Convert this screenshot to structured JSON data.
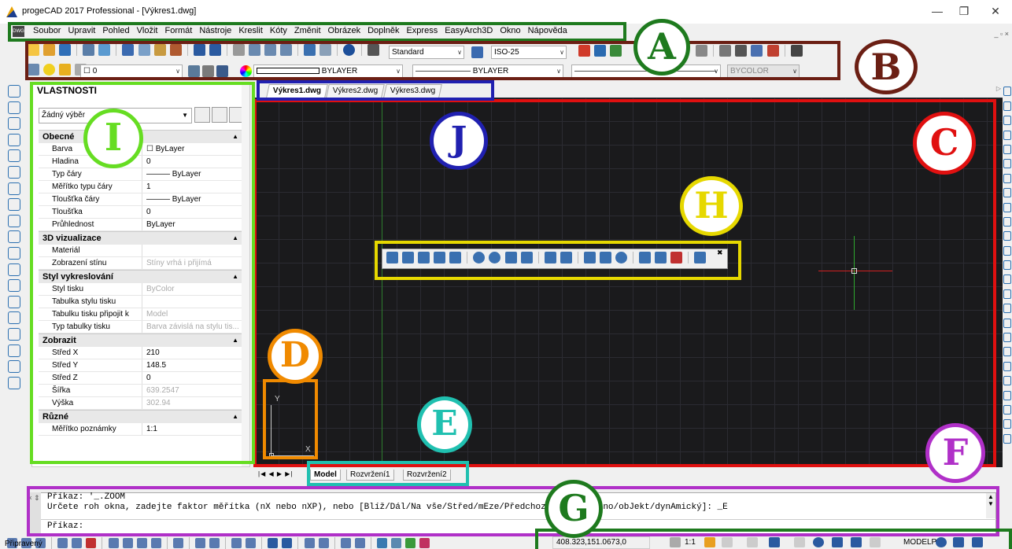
{
  "window": {
    "title": "progeCAD 2017 Professional - [Výkres1.dwg]",
    "controls": [
      "—",
      "❐",
      "✕"
    ]
  },
  "menubar": {
    "icon": "dwg-icon",
    "items": [
      "Soubor",
      "Upravit",
      "Pohled",
      "Vložit",
      "Formát",
      "Nástroje",
      "Kreslit",
      "Kóty",
      "Změnit",
      "Obrázek",
      "Doplněk",
      "Express",
      "EasyArch3D",
      "Okno",
      "Nápověda"
    ],
    "mdi_controls": "_ ▫ ×"
  },
  "toolbar": {
    "text_style": "Standard",
    "dim_style": "ISO-25",
    "layer": "0",
    "color": "BYLAYER",
    "linetype": "BYLAYER",
    "plotstyle": "BYCOLOR"
  },
  "properties": {
    "title": "VLASTNOSTI",
    "selection": "Žádný výběr",
    "categories": [
      {
        "name": "Obecné",
        "rows": [
          {
            "k": "Barva",
            "v": "☐ ByLayer"
          },
          {
            "k": "Hladina",
            "v": "0"
          },
          {
            "k": "Typ čáry",
            "v": "——— ByLayer"
          },
          {
            "k": "Měřítko typu čáry",
            "v": "1"
          },
          {
            "k": "Tloušťka čáry",
            "v": "——— ByLayer"
          },
          {
            "k": "Tloušťka",
            "v": "0"
          },
          {
            "k": "Průhlednost",
            "v": "ByLayer"
          }
        ]
      },
      {
        "name": "3D vizualizace",
        "rows": [
          {
            "k": "Materiál",
            "v": ""
          },
          {
            "k": "Zobrazení stínu",
            "v": "Stíny vrhá i přijímá",
            "dim": true
          }
        ]
      },
      {
        "name": "Styl vykreslování",
        "rows": [
          {
            "k": "Styl tisku",
            "v": "ByColor",
            "dim": true
          },
          {
            "k": "Tabulka stylu tisku",
            "v": ""
          },
          {
            "k": "Tabulku tisku připojit k",
            "v": "Model",
            "dim": true
          },
          {
            "k": "Typ tabulky tisku",
            "v": "Barva závislá na stylu tis...",
            "dim": true
          }
        ]
      },
      {
        "name": "Zobrazit",
        "rows": [
          {
            "k": "Střed X",
            "v": "210"
          },
          {
            "k": "Střed Y",
            "v": "148.5"
          },
          {
            "k": "Střed Z",
            "v": "0"
          },
          {
            "k": "Šířka",
            "v": "639.2547",
            "dim": true
          },
          {
            "k": "Výška",
            "v": "302.94",
            "dim": true
          }
        ]
      },
      {
        "name": "Různé",
        "rows": [
          {
            "k": "Měřítko poznámky",
            "v": "1:1"
          }
        ]
      }
    ]
  },
  "drawing_tabs": [
    "Výkres1.dwg",
    "Výkres2.dwg",
    "Výkres3.dwg"
  ],
  "ucs": {
    "x": "X",
    "y": "Y"
  },
  "layout_tabs": [
    "Model",
    "Rozvržení1",
    "Rozvržení2"
  ],
  "nav_buttons": "|◀ ◀ ▶ ▶|",
  "command": {
    "line1": "Příkaz: '_.ZOOM",
    "line2": "Určete roh okna, zadejte faktor měřítka (nX nebo nXP), nebo [Blíž/Dál/Na vše/Střed/mEze/Předchozí/vpRavo/Okno/obJekt/dynAmický]: _E",
    "prompt": "Příkaz:",
    "side": "× ⇕"
  },
  "status": {
    "text": "Připravený",
    "coords": "408.323,151.0673,0",
    "scale": "1:1",
    "mode": "MODELP"
  },
  "annotations": [
    {
      "letter": "A",
      "color": "#1e7a1e"
    },
    {
      "letter": "B",
      "color": "#6b1f14"
    },
    {
      "letter": "C",
      "color": "#e01010"
    },
    {
      "letter": "D",
      "color": "#f08a00"
    },
    {
      "letter": "E",
      "color": "#20c0b0"
    },
    {
      "letter": "F",
      "color": "#b030c8"
    },
    {
      "letter": "G",
      "color": "#1e7a1e"
    },
    {
      "letter": "H",
      "color": "#e6d800"
    },
    {
      "letter": "I",
      "color": "#66dd22"
    },
    {
      "letter": "J",
      "color": "#2020b0"
    }
  ]
}
